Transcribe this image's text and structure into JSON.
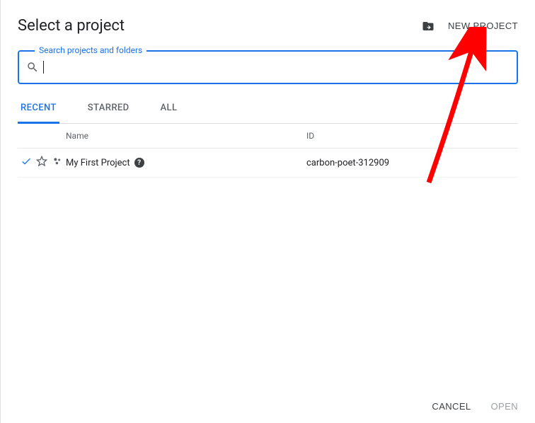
{
  "header": {
    "title": "Select a project",
    "new_project_label": "NEW PROJECT"
  },
  "search": {
    "label": "Search projects and folders",
    "value": ""
  },
  "tabs": {
    "recent": "RECENT",
    "starred": "STARRED",
    "all": "ALL",
    "active": "recent"
  },
  "table": {
    "headers": {
      "name": "Name",
      "id": "ID"
    },
    "rows": [
      {
        "name": "My First Project",
        "id": "carbon-poet-312909",
        "selected": true,
        "starred": false
      }
    ]
  },
  "footer": {
    "cancel": "CANCEL",
    "open": "OPEN"
  }
}
